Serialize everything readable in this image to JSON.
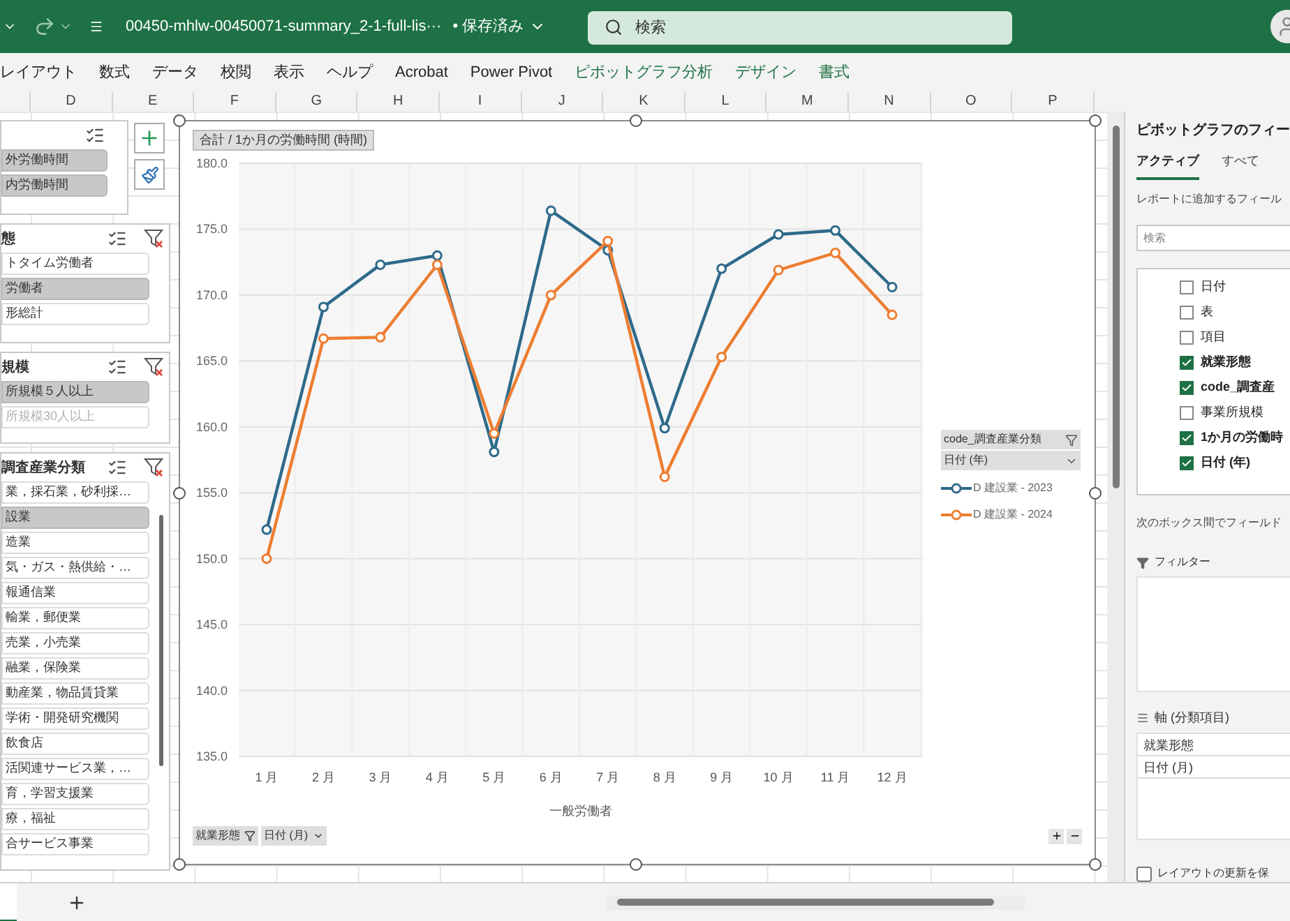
{
  "title_bar": {
    "file_name": "00450-mhlw-00450071-summary_2-1-full-lis···",
    "save_status": "• 保存済み",
    "search": {
      "placeholder": "検索"
    }
  },
  "ribbon_tabs": [
    {
      "label": "レイアウト",
      "kind": "normal"
    },
    {
      "label": "数式",
      "kind": "normal"
    },
    {
      "label": "データ",
      "kind": "normal"
    },
    {
      "label": "校閲",
      "kind": "normal"
    },
    {
      "label": "表示",
      "kind": "normal"
    },
    {
      "label": "ヘルプ",
      "kind": "normal"
    },
    {
      "label": "Acrobat",
      "kind": "normal"
    },
    {
      "label": "Power Pivot",
      "kind": "normal"
    },
    {
      "label": "ピボットグラフ分析",
      "kind": "contextual"
    },
    {
      "label": "デザイン",
      "kind": "contextual"
    },
    {
      "label": "書式",
      "kind": "contextual"
    }
  ],
  "column_headers": [
    "D",
    "E",
    "F",
    "G",
    "H",
    "I",
    "J",
    "K",
    "L",
    "M",
    "N",
    "O",
    "P"
  ],
  "slicers": [
    {
      "items": [
        {
          "label": "外労働時間",
          "selected": true,
          "disabled": false
        },
        {
          "label": "内労働時間",
          "selected": true,
          "disabled": false
        }
      ]
    },
    {
      "title": "態",
      "items": [
        {
          "label": "トタイム労働者",
          "selected": false,
          "disabled": false
        },
        {
          "label": "労働者",
          "selected": true,
          "disabled": false
        },
        {
          "label": "形総計",
          "selected": false,
          "disabled": false
        }
      ]
    },
    {
      "title": "規模",
      "items": [
        {
          "label": "所規模５人以上",
          "selected": true,
          "disabled": false
        },
        {
          "label": "所規模30人以上",
          "selected": false,
          "disabled": true
        }
      ]
    },
    {
      "title": "調査産業分類",
      "items": [
        {
          "label": "業，採石業，砂利採…",
          "selected": false,
          "disabled": false
        },
        {
          "label": "設業",
          "selected": true,
          "disabled": false
        },
        {
          "label": "造業",
          "selected": false,
          "disabled": false
        },
        {
          "label": "気・ガス・熱供給・…",
          "selected": false,
          "disabled": false
        },
        {
          "label": "報通信業",
          "selected": false,
          "disabled": false
        },
        {
          "label": "輸業，郵便業",
          "selected": false,
          "disabled": false
        },
        {
          "label": "売業，小売業",
          "selected": false,
          "disabled": false
        },
        {
          "label": "融業，保険業",
          "selected": false,
          "disabled": false
        },
        {
          "label": "動産業，物品賃貸業",
          "selected": false,
          "disabled": false
        },
        {
          "label": "学術・開発研究機関",
          "selected": false,
          "disabled": false
        },
        {
          "label": "飲食店",
          "selected": false,
          "disabled": false
        },
        {
          "label": "活関連サービス業，…",
          "selected": false,
          "disabled": false
        },
        {
          "label": "育，学習支援業",
          "selected": false,
          "disabled": false
        },
        {
          "label": "療，福祉",
          "selected": false,
          "disabled": false
        },
        {
          "label": "合サービス事業",
          "selected": false,
          "disabled": false
        }
      ]
    }
  ],
  "chart": {
    "field_button": "合計 / 1か月の労働時間 (時間)",
    "chart_data": {
      "type": "line",
      "grid": true,
      "xlabel": "一般労働者",
      "categories": [
        "1 月",
        "2 月",
        "3 月",
        "4 月",
        "5 月",
        "6 月",
        "7 月",
        "8 月",
        "9 月",
        "10 月",
        "11 月",
        "12 月"
      ],
      "series": [
        {
          "name": "D 建設業 - 2023",
          "color": "#2e6a8a",
          "marker": "circle",
          "values": [
            152.2,
            169.1,
            172.3,
            173.0,
            158.1,
            176.4,
            173.4,
            159.9,
            172.0,
            174.6,
            174.9,
            170.6
          ]
        },
        {
          "name": "D 建設業 - 2024",
          "color": "#ed7d31",
          "marker": "circle",
          "values": [
            150.0,
            166.7,
            166.8,
            172.3,
            159.5,
            170.0,
            174.1,
            156.2,
            165.3,
            171.9,
            173.2,
            168.5
          ]
        }
      ],
      "ylim": [
        135,
        180
      ],
      "yticks": [
        {
          "value": 135,
          "label": "135.0"
        },
        {
          "value": 140,
          "label": "140.0"
        },
        {
          "value": 145,
          "label": "145.0"
        },
        {
          "value": 150,
          "label": "150.0"
        },
        {
          "value": 155,
          "label": "155.0"
        },
        {
          "value": 160,
          "label": "160.0"
        },
        {
          "value": 165,
          "label": "165.0"
        },
        {
          "value": 170,
          "label": "170.0"
        },
        {
          "value": 175,
          "label": "175.0"
        },
        {
          "value": 180,
          "label": "180.0"
        }
      ]
    },
    "legend": {
      "field": "code_調査産業分類",
      "sub_field": "日付 (年)"
    },
    "axis_buttons": [
      "就業形態",
      "日付 (月)"
    ]
  },
  "field_pane": {
    "title": "ピボットグラフのフィー",
    "tabs": [
      {
        "label": "アクティブ",
        "selected": true
      },
      {
        "label": "すべて",
        "selected": false
      }
    ],
    "instruction": "レポートに追加するフィール",
    "search": {
      "placeholder": "検索"
    },
    "fields": [
      {
        "label": "日付",
        "checked": false
      },
      {
        "label": "表",
        "checked": false
      },
      {
        "label": "項目",
        "checked": false
      },
      {
        "label": "就業形態",
        "checked": true
      },
      {
        "label": "code_調査産",
        "checked": true
      },
      {
        "label": "事業所規模",
        "checked": false
      },
      {
        "label": "1か月の労働時",
        "checked": true
      },
      {
        "label": "日付 (年)",
        "checked": true
      }
    ],
    "areas_instruction": "次のボックス間でフィールド",
    "filter_area": {
      "title": "フィルター"
    },
    "axis_area": {
      "title": "軸 (分類項目)",
      "items": [
        "就業形態",
        "日付 (月)"
      ]
    },
    "defer_update": {
      "label": "レイアウトの更新を保",
      "checked": false
    }
  }
}
